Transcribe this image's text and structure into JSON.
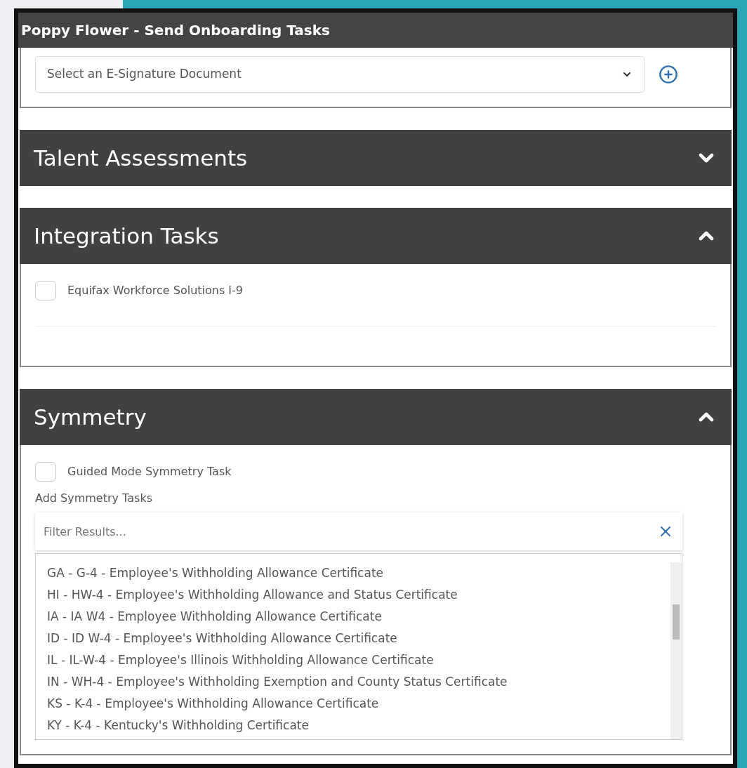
{
  "window": {
    "title": "Poppy Flower - Send Onboarding Tasks"
  },
  "esignature": {
    "placeholder": "Select an E-Signature Document"
  },
  "sections": [
    {
      "title": "Talent Assessments",
      "expanded": false
    },
    {
      "title": "Integration Tasks",
      "expanded": true,
      "kind": "tasks",
      "tasks": [
        {
          "label": "Equifax Workforce Solutions I-9",
          "checked": false
        }
      ]
    },
    {
      "title": "Symmetry",
      "expanded": true,
      "kind": "symmetry",
      "tasks": [
        {
          "label": "Guided Mode Symmetry Task",
          "checked": false
        }
      ],
      "add_label": "Add Symmetry Tasks",
      "filter": {
        "placeholder": "Filter Results..."
      },
      "options": [
        {
          "label": "GA - G-4 - Employee's Withholding Allowance Certificate"
        },
        {
          "label": "HI - HW-4 - Employee's Withholding Allowance and Status Certificate"
        },
        {
          "label": "IA - IA W4 - Employee Withholding Allowance Certificate"
        },
        {
          "label": "ID - ID W-4 - Employee's Withholding Allowance Certificate"
        },
        {
          "label": "IL - IL-W-4 - Employee's Illinois Withholding Allowance Certificate"
        },
        {
          "label": "IN - WH-4 - Employee's Withholding Exemption and County Status Certificate"
        },
        {
          "label": "KS - K-4 - Employee's Withholding Allowance Certificate"
        },
        {
          "label": "KY - K-4 - Kentucky's Withholding Certificate"
        }
      ]
    }
  ]
}
